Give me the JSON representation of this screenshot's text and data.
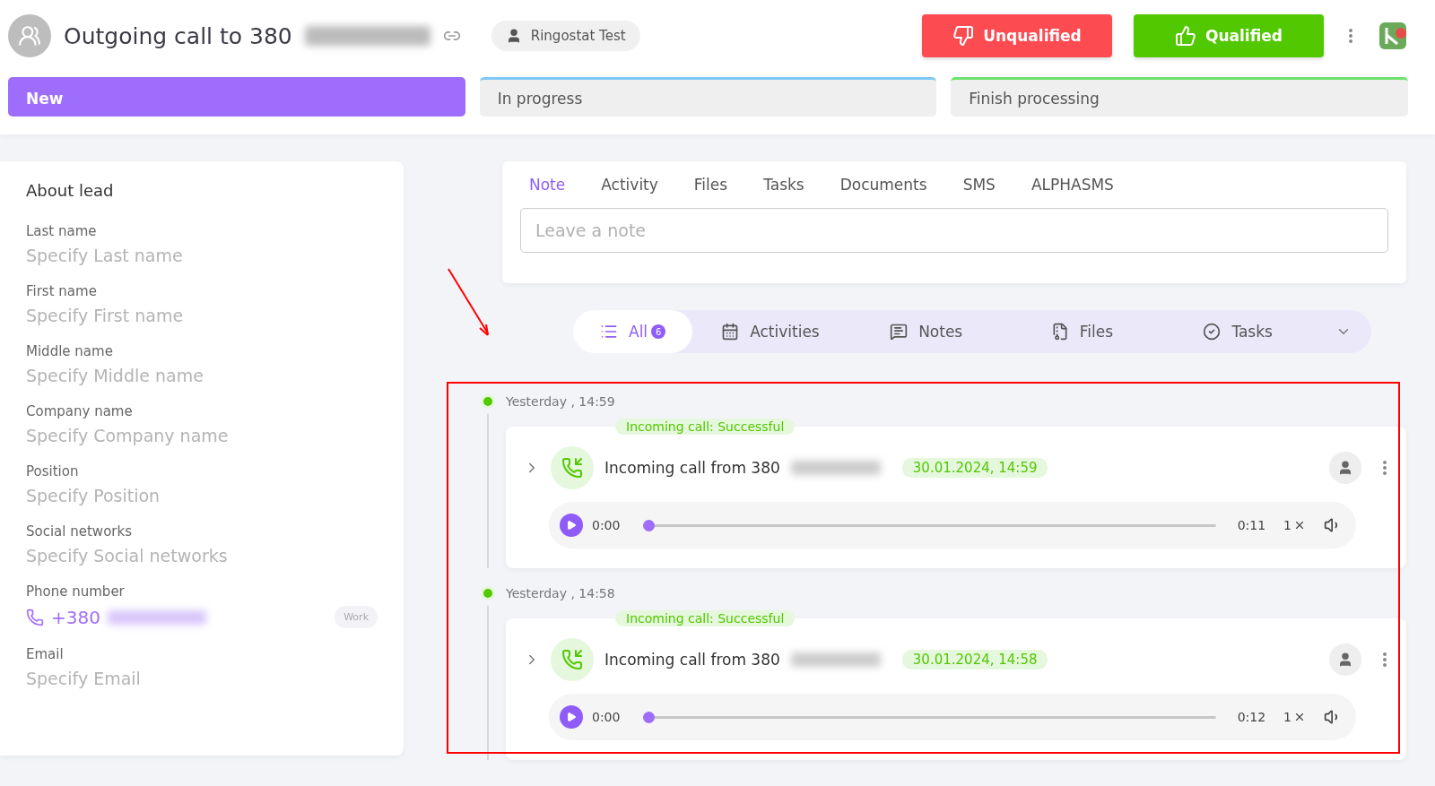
{
  "header": {
    "title": "Outgoing call to 380",
    "assignee": "Ringostat Test",
    "buttons": [
      {
        "label": "Unqualified",
        "kind": "negative"
      },
      {
        "label": "Qualified",
        "kind": "positive"
      }
    ]
  },
  "stages": [
    {
      "label": "New",
      "selected": true,
      "color": "#9f6dfb"
    },
    {
      "label": "In progress",
      "selected": false,
      "color": "#7ec8f5"
    },
    {
      "label": "Finish processing",
      "selected": false,
      "color": "#6de26d"
    }
  ],
  "lead": {
    "title": "About lead",
    "fields": [
      {
        "label": "Last name",
        "placeholder": "Specify Last name",
        "kind": "text"
      },
      {
        "label": "First name",
        "placeholder": "Specify First name",
        "kind": "text"
      },
      {
        "label": "Middle name",
        "placeholder": "Specify Middle name",
        "kind": "text"
      },
      {
        "label": "Company name",
        "placeholder": "Specify Company name",
        "kind": "text"
      },
      {
        "label": "Position",
        "placeholder": "Specify Position",
        "kind": "text"
      },
      {
        "label": "Social networks",
        "placeholder": "Specify Social networks",
        "kind": "text"
      },
      {
        "label": "Phone number",
        "value": "+380",
        "tag": "Work",
        "kind": "phone"
      },
      {
        "label": "Email",
        "placeholder": "Specify Email",
        "kind": "text"
      }
    ]
  },
  "note_tabs": [
    {
      "label": "Note",
      "selected": true
    },
    {
      "label": "Activity",
      "selected": false
    },
    {
      "label": "Files",
      "selected": false
    },
    {
      "label": "Tasks",
      "selected": false
    },
    {
      "label": "Documents",
      "selected": false
    },
    {
      "label": "SMS",
      "selected": false
    },
    {
      "label": "ALPHASMS",
      "selected": false
    }
  ],
  "note": {
    "placeholder": "Leave a note"
  },
  "filters": [
    {
      "label": "All",
      "count": "6",
      "selected": true,
      "kind": "all"
    },
    {
      "label": "Activities",
      "selected": false,
      "kind": "activities"
    },
    {
      "label": "Notes",
      "selected": false,
      "kind": "notes"
    },
    {
      "label": "Files",
      "selected": false,
      "kind": "files"
    },
    {
      "label": "Tasks",
      "selected": false,
      "kind": "tasks"
    }
  ],
  "events": [
    {
      "time": "Yesterday , 14:59",
      "status": "Incoming call: Successful",
      "title": "Incoming call from 380",
      "date": "30.01.2024, 14:59",
      "position": "0:00",
      "duration": "0:11",
      "speed": "1",
      "level": 0
    },
    {
      "time": "Yesterday , 14:58",
      "status": "Incoming call: Successful",
      "title": "Incoming call from 380",
      "date": "30.01.2024, 14:58",
      "position": "0:00",
      "duration": "0:12",
      "speed": "1",
      "level": 0
    }
  ]
}
